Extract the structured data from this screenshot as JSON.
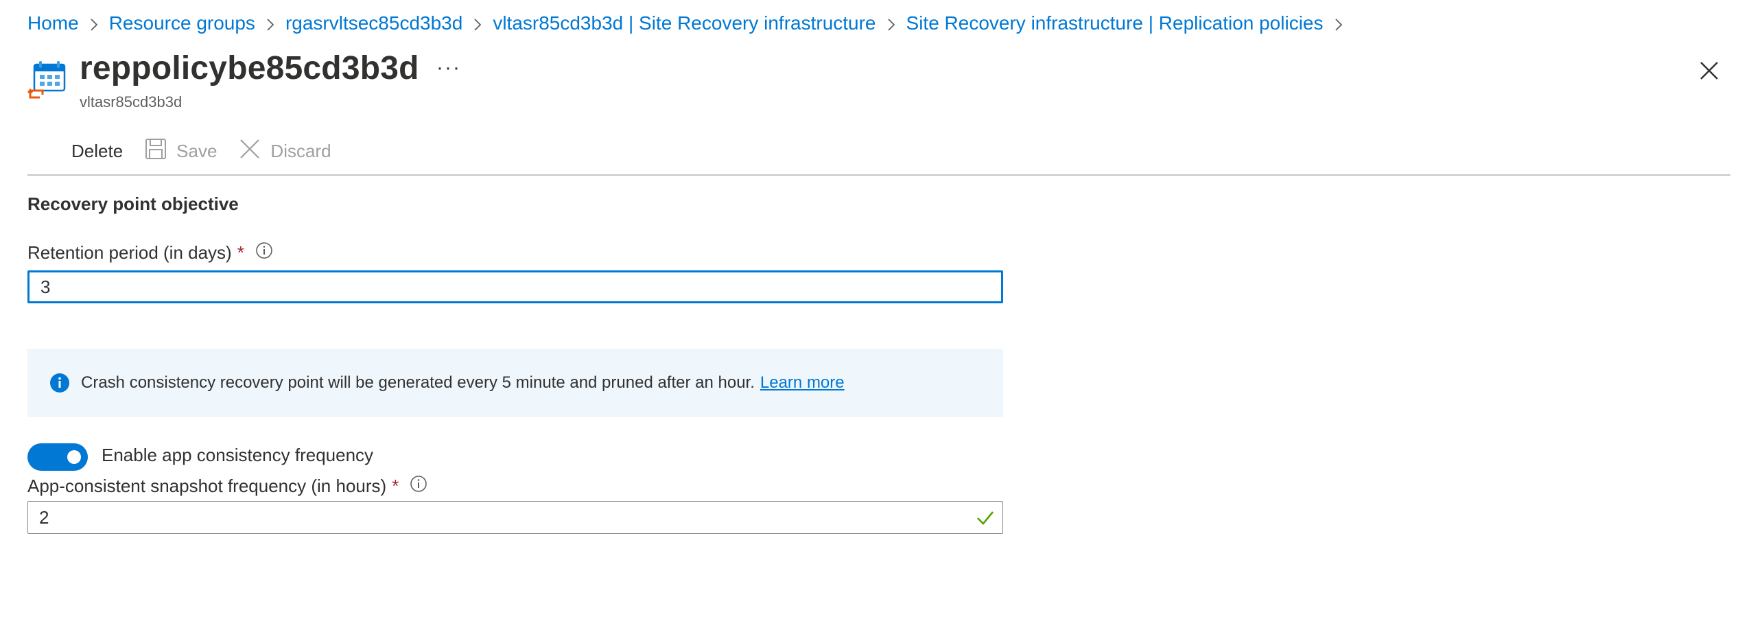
{
  "breadcrumb": {
    "items": [
      {
        "label": "Home"
      },
      {
        "label": "Resource groups"
      },
      {
        "label": "rgasrvltsec85cd3b3d"
      },
      {
        "label": "vltasr85cd3b3d | Site Recovery infrastructure"
      },
      {
        "label": "Site Recovery infrastructure | Replication policies"
      }
    ]
  },
  "header": {
    "title": "reppolicybe85cd3b3d",
    "subtitle": "vltasr85cd3b3d",
    "more_label": "···",
    "icon": "calendar-sync-icon"
  },
  "toolbar": {
    "delete_label": "Delete",
    "save_label": "Save",
    "discard_label": "Discard"
  },
  "form": {
    "section_title": "Recovery point objective",
    "retention": {
      "label": "Retention period (in days)",
      "required_mark": "*",
      "value": "3"
    },
    "info": {
      "text": "Crash consistency recovery point will be generated every 5 minute and pruned after an hour.",
      "link": "Learn more"
    },
    "app_consistency_toggle": {
      "label": "Enable app consistency frequency",
      "on": true
    },
    "snapshot_frequency": {
      "label": "App-consistent snapshot frequency (in hours)",
      "required_mark": "*",
      "value": "2"
    }
  },
  "colors": {
    "accent": "#0078d4",
    "required": "#a4262c",
    "valid": "#57a300",
    "info_bg": "#eff6fc"
  }
}
